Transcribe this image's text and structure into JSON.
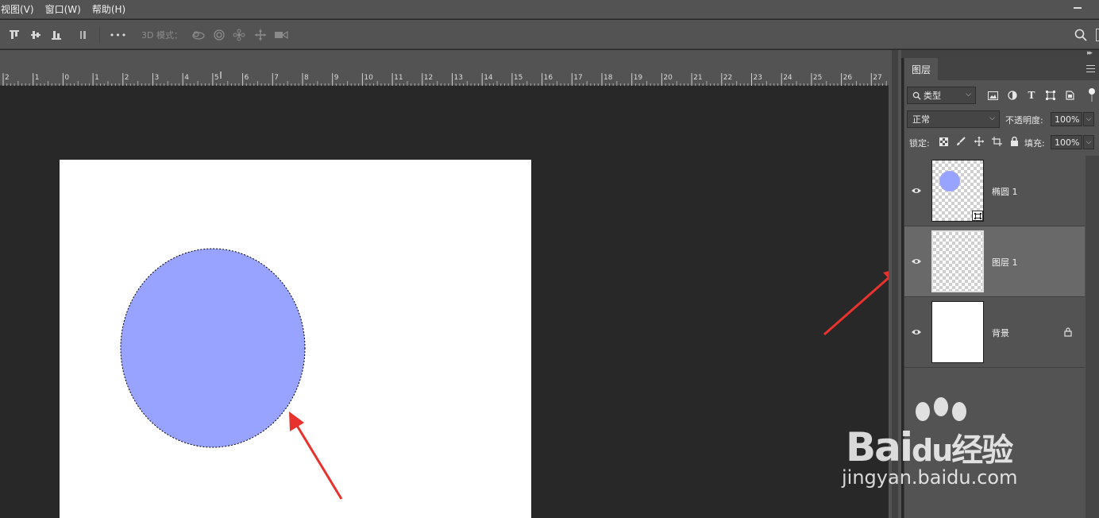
{
  "menubar": {
    "items": [
      "视图(V)",
      "窗口(W)",
      "帮助(H)"
    ]
  },
  "optionsbar": {
    "mode3d_label": "3D 模式：",
    "more_label": "•••"
  },
  "ruler": {
    "labels": [
      "2",
      "1",
      "0",
      "1",
      "2",
      "3",
      "4",
      "5",
      "6",
      "7",
      "8",
      "9",
      "10",
      "11",
      "12",
      "13",
      "14",
      "15",
      "16",
      "17",
      "18",
      "19",
      "20",
      "21",
      "22",
      "23",
      "24",
      "25",
      "26",
      "27"
    ]
  },
  "canvas": {
    "ellipse_color": "#98a3ff",
    "document_color": "#ffffff",
    "arrow_color": "#e8322d"
  },
  "layers_panel": {
    "tab_label": "图层",
    "filter": {
      "label": "类型"
    },
    "blend_mode": "正常",
    "opacity_label": "不透明度:",
    "opacity_value": "100%",
    "lock_label": "锁定:",
    "fill_label": "填充:",
    "fill_value": "100%",
    "layers": [
      {
        "name": "椭圆 1",
        "type": "shape"
      },
      {
        "name": "图层 1",
        "type": "pixel",
        "selected": true
      },
      {
        "name": "背景",
        "type": "background",
        "locked": true
      }
    ]
  },
  "watermark": {
    "brand": "Bai",
    "brand2": "du",
    "brand3": "经验",
    "url": "jingyan.baidu.com"
  }
}
